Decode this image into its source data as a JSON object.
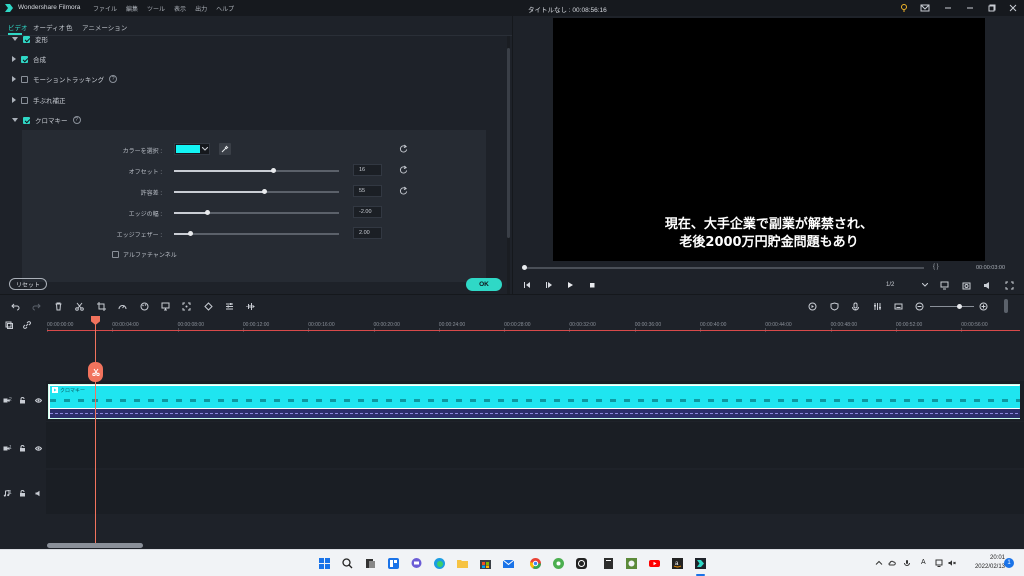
{
  "app": {
    "name": "Wondershare Filmora",
    "menu": [
      "ファイル",
      "編集",
      "ツール",
      "表示",
      "出力",
      "ヘルプ"
    ],
    "doc_title": "タイトルなし : 00:08:56:16"
  },
  "tabs": [
    "ビデオ",
    "オーディオ",
    "色",
    "アニメーション"
  ],
  "options": {
    "partial_top": "変形",
    "composite": "合成",
    "motion_tracking": "モーショントラッキング",
    "stabilize": "手ぶれ補正",
    "chroma": "クロマキー"
  },
  "chroma": {
    "color_label": "カラーを選択 :",
    "color": "#13f4f4",
    "params": [
      {
        "label": "オフセット :",
        "value": "16",
        "level": 0.6
      },
      {
        "label": "許容差 :",
        "value": "55",
        "level": 0.55
      },
      {
        "label": "エッジの幅 :",
        "value": "-2.00",
        "level": 0.2
      },
      {
        "label": "エッジフェザー :",
        "value": "2.00",
        "level": 0.1
      }
    ],
    "alpha_label": "アルファチャンネル"
  },
  "buttons": {
    "reset": "リセット",
    "ok": "OK"
  },
  "preview": {
    "subtitle_line1": "現在、大手企業で副業が解禁され、",
    "subtitle_line2": "老後2000万円貯金問題もあり",
    "timecode": "00:00:03:00",
    "brackets": "{      }",
    "quality": "1/2"
  },
  "ruler": [
    "00:00:00:00",
    "00:00:04:00",
    "00:00:08:00",
    "00:00:12:00",
    "00:00:16:00",
    "00:00:20:00",
    "00:00:24:00",
    "00:00:28:00",
    "00:00:32:00",
    "00:00:36:00",
    "00:00:40:00",
    "00:00:44:00",
    "00:00:48:00",
    "00:00:52:00",
    "00:00:56:00"
  ],
  "clip": {
    "name": "クロマキー"
  },
  "tracks": [
    {
      "label": "2"
    },
    {
      "label": "1"
    },
    {
      "label": "1"
    }
  ],
  "taskbar": {
    "time": "20:01",
    "date": "2022/02/13",
    "notifications": "1",
    "ime": "A"
  }
}
